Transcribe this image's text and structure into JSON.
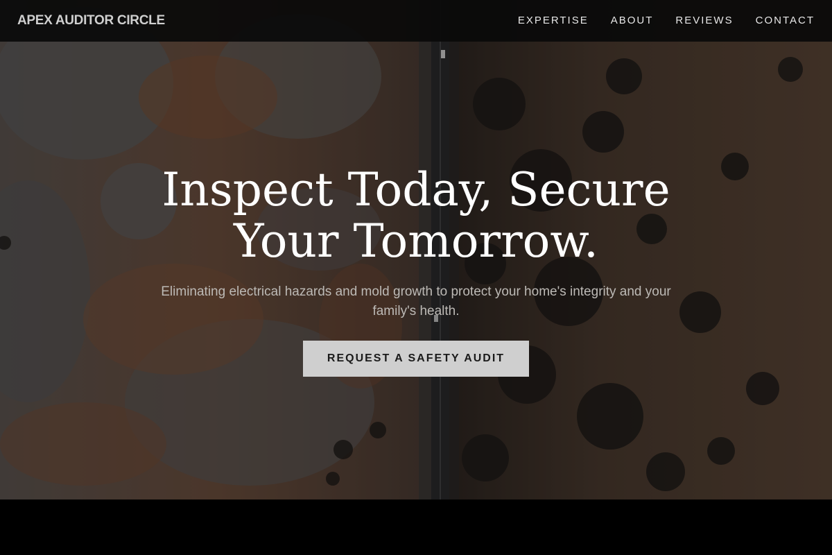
{
  "header": {
    "brand": "APEX AUDITOR CIRCLE",
    "nav": [
      {
        "label": "EXPERTISE"
      },
      {
        "label": "ABOUT"
      },
      {
        "label": "REVIEWS"
      },
      {
        "label": "CONTACT"
      }
    ]
  },
  "hero": {
    "title": "Inspect Today, Secure Your Tomorrow.",
    "subtitle": "Eliminating electrical hazards and mold growth to protect your home's integrity and your family's health.",
    "cta_label": "REQUEST A SAFETY AUDIT"
  },
  "colors": {
    "nav_background": "#0a0a0a",
    "text_primary": "#ffffff",
    "text_subtle": "#bdbab6",
    "cta_background": "#cfcfcf",
    "cta_text": "#1a1a1a",
    "page_background": "#000000"
  }
}
